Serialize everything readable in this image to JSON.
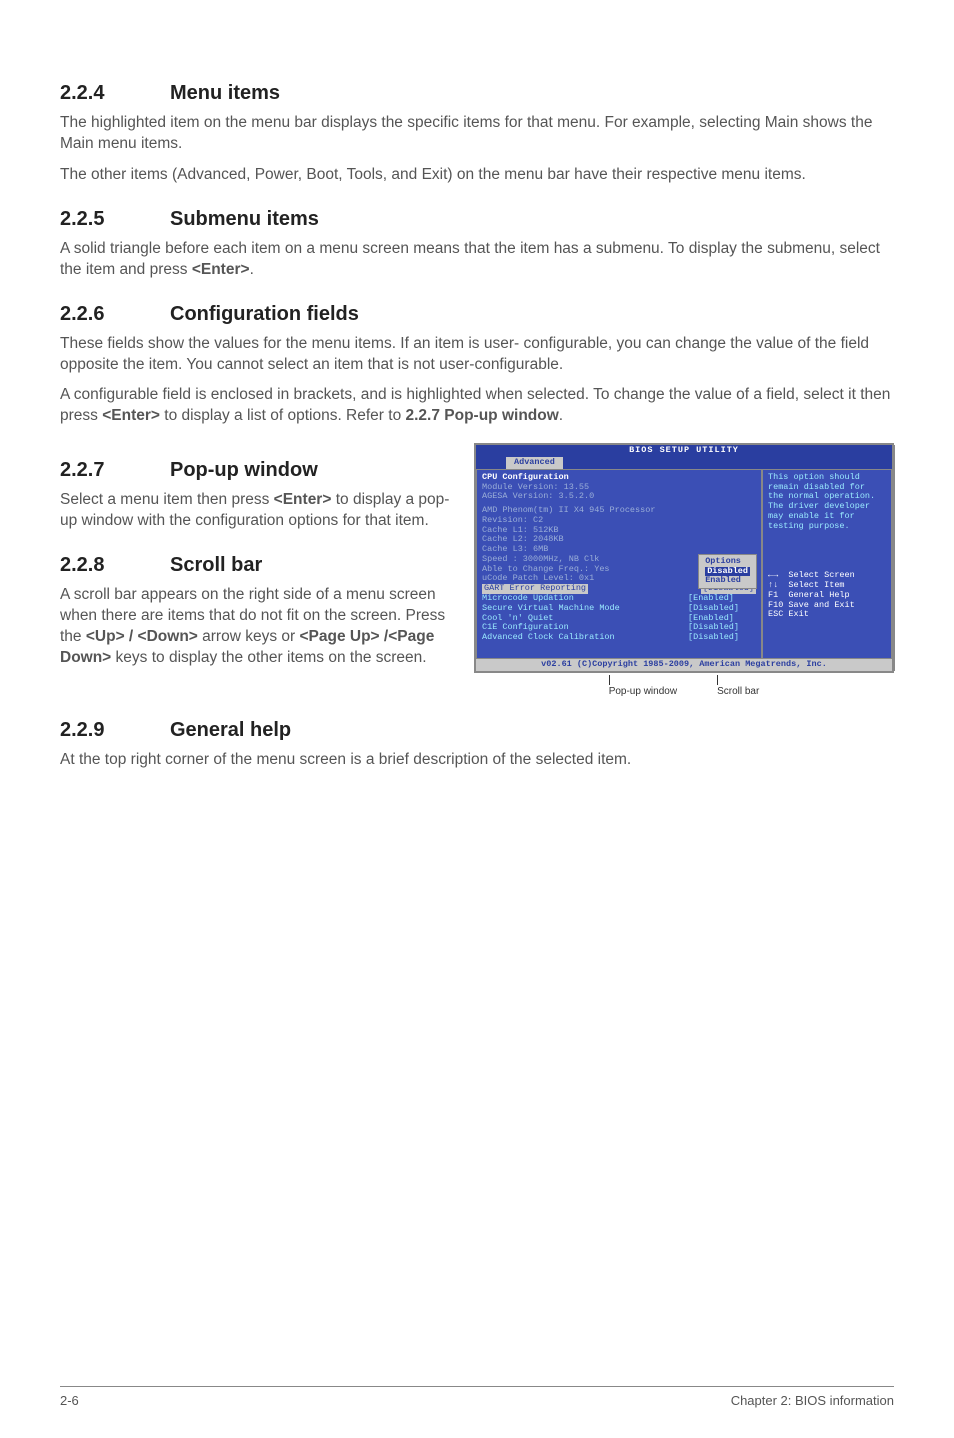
{
  "sections": {
    "s224": {
      "num": "2.2.4",
      "title": "Menu items",
      "p1": "The highlighted item on the menu bar displays the specific items for that menu. For example, selecting Main shows the Main menu items.",
      "p2": "The other items (Advanced, Power, Boot, Tools, and Exit) on the menu bar have their respective menu items."
    },
    "s225": {
      "num": "2.2.5",
      "title": "Submenu items",
      "p1a": "A solid triangle before each item on a menu screen means that the item has a submenu. To display the submenu, select the item and press ",
      "p1b": "<Enter>",
      "p1c": "."
    },
    "s226": {
      "num": "2.2.6",
      "title": "Configuration fields",
      "p1": "These fields show the values for the menu items. If an item is user- configurable, you can change the value of the field opposite the item. You cannot select an item that is not user-configurable.",
      "p2a": "A configurable field is enclosed in brackets, and is highlighted when selected. To change the value of a field, select it then press ",
      "p2b": "<Enter>",
      "p2c": " to display a list of options. Refer to ",
      "p2d": "2.2.7 Pop-up window",
      "p2e": "."
    },
    "s227": {
      "num": "2.2.7",
      "title": "Pop-up window",
      "p1a": "Select a menu item then press ",
      "p1b": "<Enter>",
      "p1c": " to display a pop-up window with the configuration options for that item."
    },
    "s228": {
      "num": "2.2.8",
      "title": "Scroll bar",
      "p1a": "A scroll bar appears on the right side of a menu screen when there are items that do not fit on the screen. Press the ",
      "p1b": "<Up> / <Down>",
      "p1c": " arrow keys or ",
      "p1d": "<Page Up> /<Page Down>",
      "p1e": " keys to display the other items on the screen."
    },
    "s229": {
      "num": "2.2.9",
      "title": "General help",
      "p1": "At the top right corner of the menu screen is a brief description of the selected item."
    }
  },
  "bios": {
    "title": "BIOS SETUP UTILITY",
    "tab": "Advanced",
    "heading": "CPU Configuration",
    "module": "Module Version: 13.55",
    "agesa": "AGESA Version: 3.5.2.0",
    "cpu_lines": {
      "l1": "AMD Phenom(tm) II X4 945 Processor",
      "l2": "Revision: C2",
      "l3": "Cache L1: 512KB",
      "l4": "Cache L2: 2048KB",
      "l5": "Cache L3: 6MB",
      "l6": "Speed  : 3000MHz, NB Clk",
      "l7": "Able to Change Freq.: Yes",
      "l8": "uCode Patch Level: 0x1"
    },
    "popup": {
      "title": "Options",
      "opt1": "Disabled",
      "opt2": "Enabled"
    },
    "hl_row": {
      "label": "GART Error Reporting",
      "val": "[Disabled]"
    },
    "rows": {
      "r1": {
        "label": "Microcode Updation",
        "val": "[Enabled]"
      },
      "r2": {
        "label": "Secure Virtual Machine Mode",
        "val": "[Disabled]"
      },
      "r3": {
        "label": "Cool 'n' Quiet",
        "val": "[Enabled]"
      },
      "r4": {
        "label": "C1E Configuration",
        "val": "[Disabled]"
      },
      "r5": {
        "label": "Advanced Clock Calibration",
        "val": "[Disabled]"
      }
    },
    "help": {
      "h1": "This option should",
      "h2": "remain disabled for",
      "h3": "the normal operation.",
      "h4": "The driver developer",
      "h5": "may enable it for",
      "h6": "testing purpose."
    },
    "keys": {
      "k1b": "Select Screen",
      "k2b": "Select Item",
      "k3a": "F1",
      "k3b": "General Help",
      "k4a": "F10",
      "k4b": "Save and Exit",
      "k5a": "ESC",
      "k5b": "Exit"
    },
    "footer": "v02.61 (C)Copyright 1985-2009, American Megatrends, Inc.",
    "figlabel1": "Pop-up window",
    "figlabel2": "Scroll bar"
  },
  "page_footer": {
    "left": "2-6",
    "right": "Chapter 2: BIOS information"
  }
}
